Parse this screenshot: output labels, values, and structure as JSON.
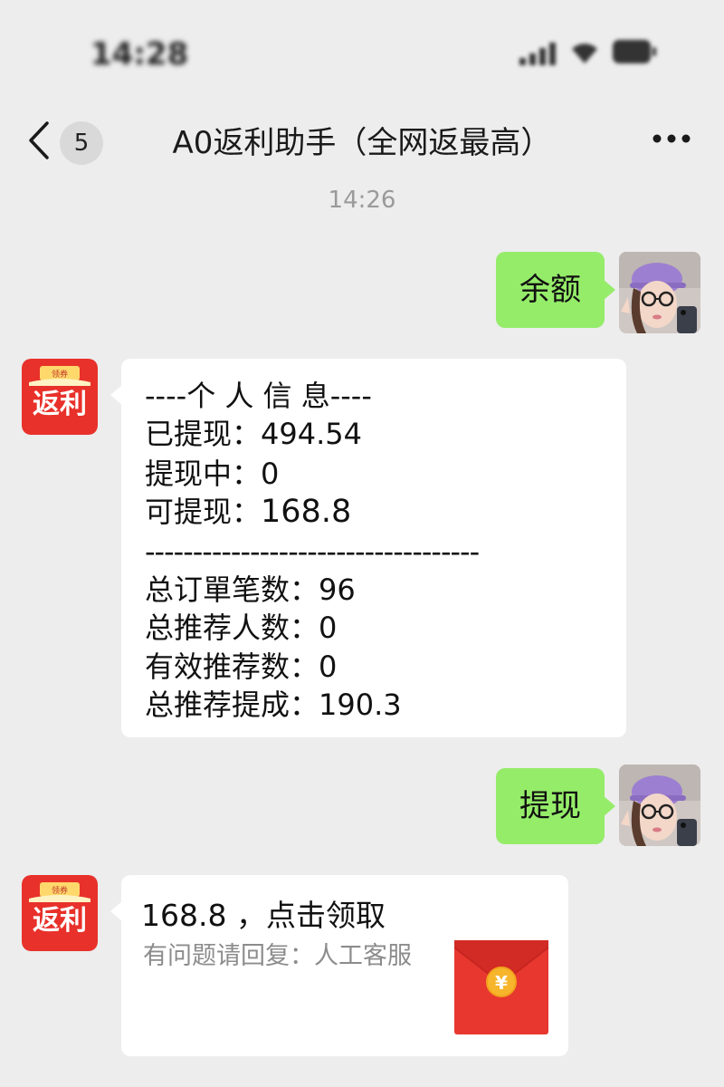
{
  "status_bar": {
    "time": "14:28"
  },
  "nav": {
    "unread_count": "5",
    "title": "A0返利助手（全网返最高）"
  },
  "chat": {
    "timestamp": "14:26",
    "msg1": "余额",
    "info": {
      "header": "----个 人 信 息----",
      "withdrawn_label": "已提现：",
      "withdrawn_value": "494.54",
      "pending_label": "提现中：",
      "pending_value": "0",
      "available_label": "可提现：",
      "available_value": "168.8",
      "divider": "-----------------------------------",
      "orders_label": "总订單笔数：",
      "orders_value": "96",
      "referrals_label": "总推荐人数：",
      "referrals_value": "0",
      "valid_referrals_label": "有效推荐数：",
      "valid_referrals_value": "0",
      "commission_label": "总推荐提成：",
      "commission_value": "190.3"
    },
    "msg2": "提现",
    "claim": {
      "title": "168.8 ，点击领取",
      "subtitle": "有问题请回复：人工客服"
    },
    "bot_avatar": {
      "banner_text": "领券",
      "label": "返利"
    }
  },
  "colors": {
    "background": "#ededed",
    "outgoing_bubble": "#95ec69",
    "incoming_bubble": "#ffffff",
    "bot_avatar_red": "#e8312a",
    "red_packet": "#e8372f",
    "coin_gold": "#f7b52b"
  },
  "icons": {
    "back": "chevron-left-icon",
    "more": "more-dots-icon",
    "red_packet": "red-packet-icon"
  }
}
